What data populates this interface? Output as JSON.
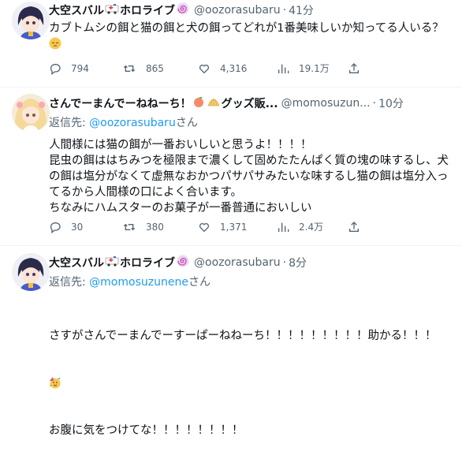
{
  "tweets": [
    {
      "name": "大空スバル",
      "name_suffix": "ホロライブ",
      "handle": "@oozorasubaru",
      "time": "41分",
      "reply_label": "",
      "reply_to": "",
      "reply_suffix": "",
      "text": "カブトムシの餌と猫の餌と犬の餌ってどれが1番美味しいか知ってる人いる？",
      "stats": {
        "replies": "794",
        "retweets": "865",
        "likes": "4,316",
        "views": "19.1万"
      }
    },
    {
      "name": "さんでーまんでーねねーち！",
      "name_suffix": "グッズ販...",
      "handle": "@momosuzun...",
      "time": "10分",
      "reply_label": "返信先: ",
      "reply_to": "@oozorasubaru",
      "reply_suffix": "さん",
      "text": "人間様には猫の餌が一番おいしいと思うよ！！！！\n昆虫の餌ははちみつを極限まで濃くして固めたたんぱく質の塊の味するし、犬の餌は塩分がなくて虚無なおかつパサパサみたいな味するし猫の餌は塩分入ってるから人間様の口によく合います。\nちなみにハムスターのお菓子が一番普通においしい",
      "stats": {
        "replies": "30",
        "retweets": "380",
        "likes": "1,371",
        "views": "2.4万"
      }
    },
    {
      "name": "大空スバル",
      "name_suffix": "ホロライブ",
      "handle": "@oozorasubaru",
      "time": "8分",
      "reply_label": "返信先: ",
      "reply_to": "@momosuzunene",
      "reply_suffix": "さん",
      "text_line1": "さすがさんでーまんでーすーぱーねねーち！！！！！！！！！助かる！！！",
      "text_line3": "お腹に気をつけてな！！！！！！！！"
    }
  ]
}
